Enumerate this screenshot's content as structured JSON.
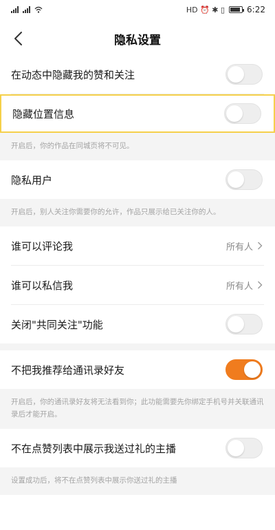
{
  "status_bar": {
    "time": "6:22",
    "glyphs": "HD ⏰ ✱ ▯"
  },
  "nav": {
    "title": "隐私设置",
    "back_icon": "chevron-left-icon"
  },
  "colors": {
    "accent": "#f07c1e",
    "highlight": "#f5d04a"
  },
  "settings": {
    "hide_likes_follows": {
      "label": "在动态中隐藏我的赞和关注",
      "enabled": false
    },
    "hide_location": {
      "label": "隐藏位置信息",
      "enabled": false,
      "note": "开启后，你的作品在同城页将不可见。"
    },
    "private_user": {
      "label": "隐私用户",
      "enabled": false,
      "note": "开启后，别人关注你需要你的允许，作品只展示给已关注你的人。"
    },
    "who_comment": {
      "label": "谁可以评论我",
      "value": "所有人"
    },
    "who_message": {
      "label": "谁可以私信我",
      "value": "所有人"
    },
    "close_mutual": {
      "label": "关闭\"共同关注\"功能",
      "enabled": false
    },
    "no_recommend_contacts": {
      "label": "不把我推荐给通讯录好友",
      "enabled": true,
      "note": "开启后，你的通讯录好友将无法看到你；此功能需要先你绑定手机号并关联通讯录后才能开启。"
    },
    "hide_gift_streamers": {
      "label": "不在点赞列表中展示我送过礼的主播",
      "enabled": false,
      "note": "设置成功后，将不在点赞列表中展示你送过礼的主播"
    }
  }
}
